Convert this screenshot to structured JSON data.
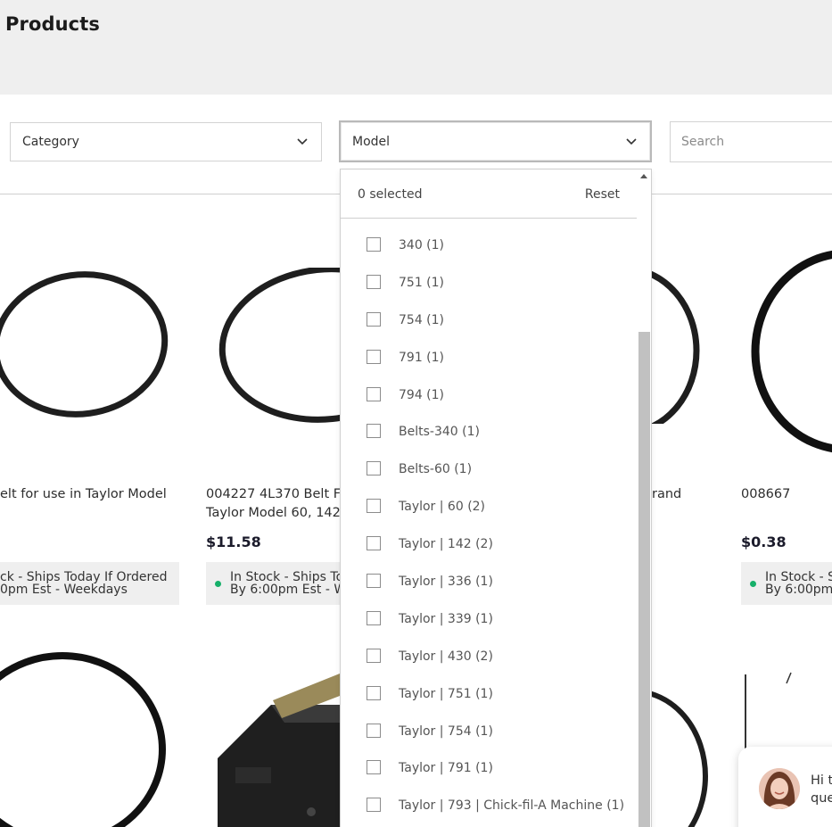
{
  "page": {
    "title": "Products"
  },
  "filters": {
    "category_label": "Category",
    "model_label": "Model",
    "search_placeholder": "Search"
  },
  "model_dropdown": {
    "selected_text": "0 selected",
    "reset_label": "Reset",
    "options": [
      "340 (1)",
      "751 (1)",
      "754 (1)",
      "791 (1)",
      "794 (1)",
      "Belts-340 (1)",
      "Belts-60 (1)",
      "Taylor | 60 (2)",
      "Taylor | 142 (2)",
      "Taylor | 336 (1)",
      "Taylor | 339 (1)",
      "Taylor | 430 (2)",
      "Taylor | 751 (1)",
      "Taylor | 754 (1)",
      "Taylor | 791 (1)",
      "Taylor | 793 | Chick-fil-A Machine (1)"
    ]
  },
  "products": [
    {
      "name_line1": "elt for use in Taylor Model",
      "name_line2": "",
      "price": "",
      "stock_line1": "ck - Ships Today If Ordered",
      "stock_line2": "0pm Est - Weekdays"
    },
    {
      "name_line1": "004227 4L370 Belt F",
      "name_line2": "Taylor Model 60, 142",
      "price": "$11.58",
      "stock_line1": "In Stock - Ships To",
      "stock_line2": "By 6:00pm Est - W"
    },
    {
      "name_line1": "rand",
      "name_line2": "",
      "price": "",
      "stock_line1": "",
      "stock_line2": ""
    },
    {
      "name_line1": "008667",
      "name_line2": "",
      "price": "$0.38",
      "stock_line1": "In Stock - S",
      "stock_line2": "By 6:00pm"
    }
  ],
  "chat": {
    "line1": "Hi t",
    "line2": "que"
  },
  "colors": {
    "header_bg": "#efefef",
    "stock_dot": "#16b06a",
    "scrollbar_thumb": "#c1c1c1"
  }
}
